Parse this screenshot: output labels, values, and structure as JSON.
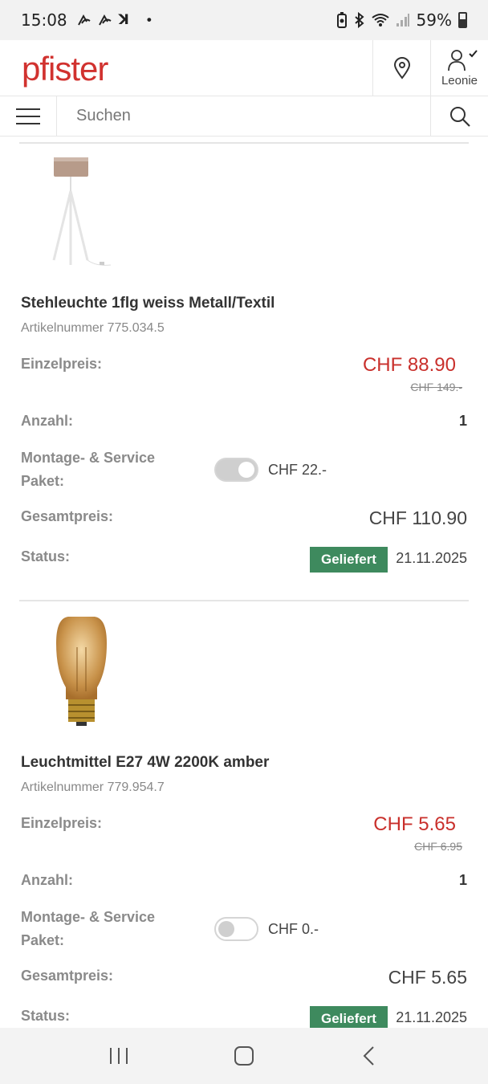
{
  "status_bar": {
    "time": "15:08",
    "notifications": [
      "ꓘ",
      "•"
    ],
    "battery": "59%"
  },
  "header": {
    "logo": "pfister",
    "user_name": "Leonie"
  },
  "search": {
    "placeholder": "Suchen"
  },
  "labels": {
    "unit_price": "Einzelpreis:",
    "quantity": "Anzahl:",
    "service_line1": "Montage- & Service",
    "service_line2": "Paket:",
    "total": "Gesamtpreis:",
    "status": "Status:"
  },
  "items": [
    {
      "title": "Stehleuchte 1flg weiss Metall/Textil",
      "article_number": "Artikelnummer 775.034.5",
      "price": "CHF 88.90",
      "old_price": "CHF 149.-",
      "quantity": "1",
      "service_enabled": true,
      "service_price": "CHF 22.-",
      "total": "CHF 110.90",
      "status": "Geliefert",
      "status_date": "21.11.2025",
      "image_icon": "floor-lamp-image"
    },
    {
      "title": "Leuchtmittel E27 4W 2200K amber",
      "article_number": "Artikelnummer 779.954.7",
      "price": "CHF 5.65",
      "old_price": "CHF 6.95",
      "quantity": "1",
      "service_enabled": false,
      "service_price": "CHF 0.-",
      "total": "CHF 5.65",
      "status": "Geliefert",
      "status_date": "21.11.2025",
      "image_icon": "light-bulb-image"
    }
  ],
  "colors": {
    "brand": "#d1322f",
    "sale_price": "#c9302c",
    "status_green": "#3e8a5e"
  }
}
